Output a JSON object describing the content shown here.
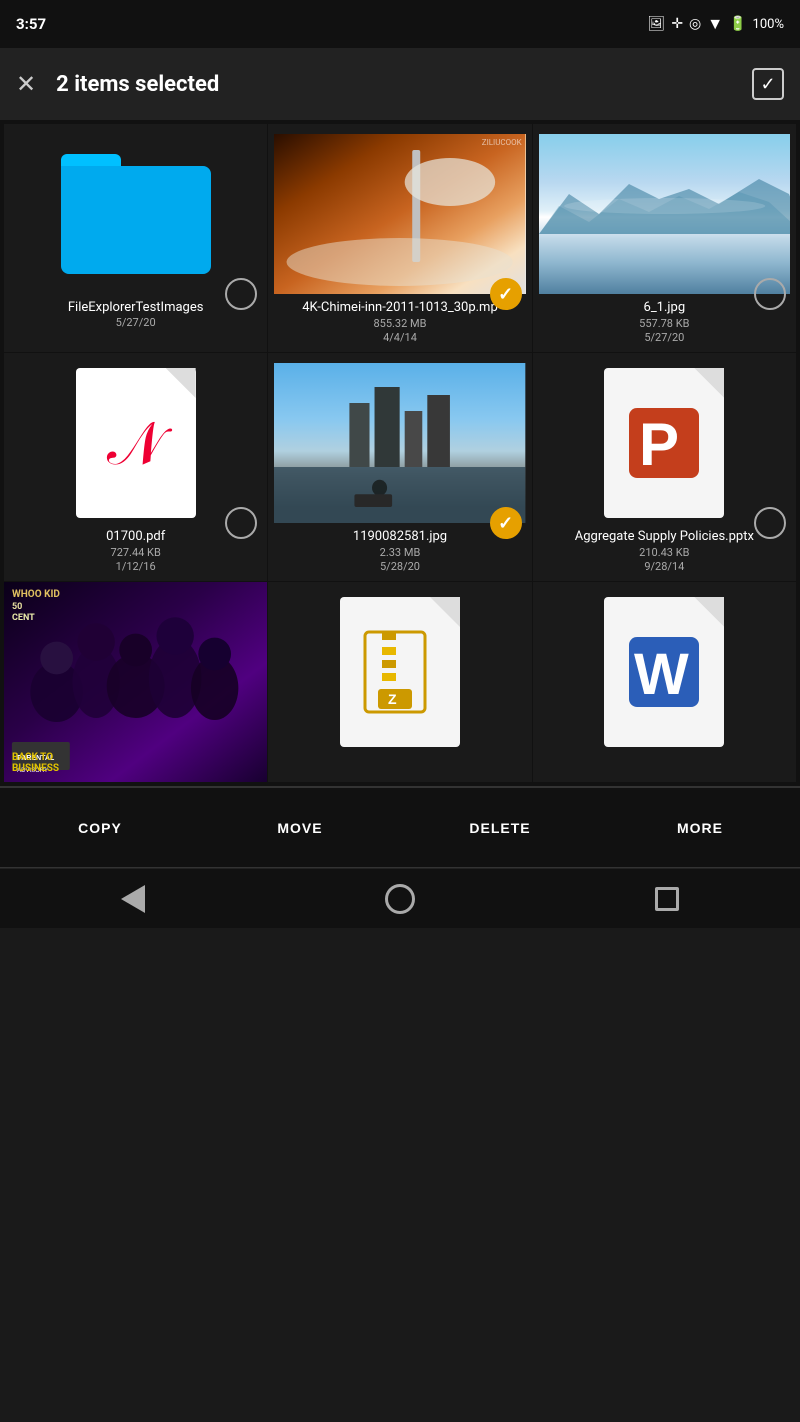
{
  "statusBar": {
    "time": "3:57",
    "battery": "100%"
  },
  "actionBar": {
    "title": "2 items selected",
    "closeLabel": "×"
  },
  "files": [
    {
      "id": "file-1",
      "type": "folder",
      "name": "FileExplorerTestImages",
      "date": "5/27/20",
      "selected": false
    },
    {
      "id": "file-2",
      "type": "video",
      "name": "4K-Chimei-inn-2011-1013_30p.mp",
      "size": "855.32 MB",
      "date": "4/4/14",
      "selected": true
    },
    {
      "id": "file-3",
      "type": "image-sky",
      "name": "6_1.jpg",
      "size": "557.78 KB",
      "date": "5/27/20",
      "selected": false
    },
    {
      "id": "file-4",
      "type": "pdf",
      "name": "01700.pdf",
      "size": "727.44 KB",
      "date": "1/12/16",
      "selected": false
    },
    {
      "id": "file-5",
      "type": "image-city",
      "name": "1190082581.jpg",
      "size": "2.33 MB",
      "date": "5/28/20",
      "selected": true
    },
    {
      "id": "file-6",
      "type": "pptx",
      "name": "Aggregate Supply Policies.pptx",
      "size": "210.43 KB",
      "date": "9/28/14",
      "selected": false
    },
    {
      "id": "file-7",
      "type": "album",
      "name": "",
      "selected": false
    },
    {
      "id": "file-8",
      "type": "zip",
      "name": "",
      "selected": false
    },
    {
      "id": "file-9",
      "type": "docx",
      "name": "",
      "selected": false
    }
  ],
  "bottomActions": {
    "copy": "COPY",
    "move": "MOVE",
    "delete": "DELETE",
    "more": "MORE"
  },
  "navBar": {
    "back": "back",
    "home": "home",
    "recent": "recent"
  }
}
